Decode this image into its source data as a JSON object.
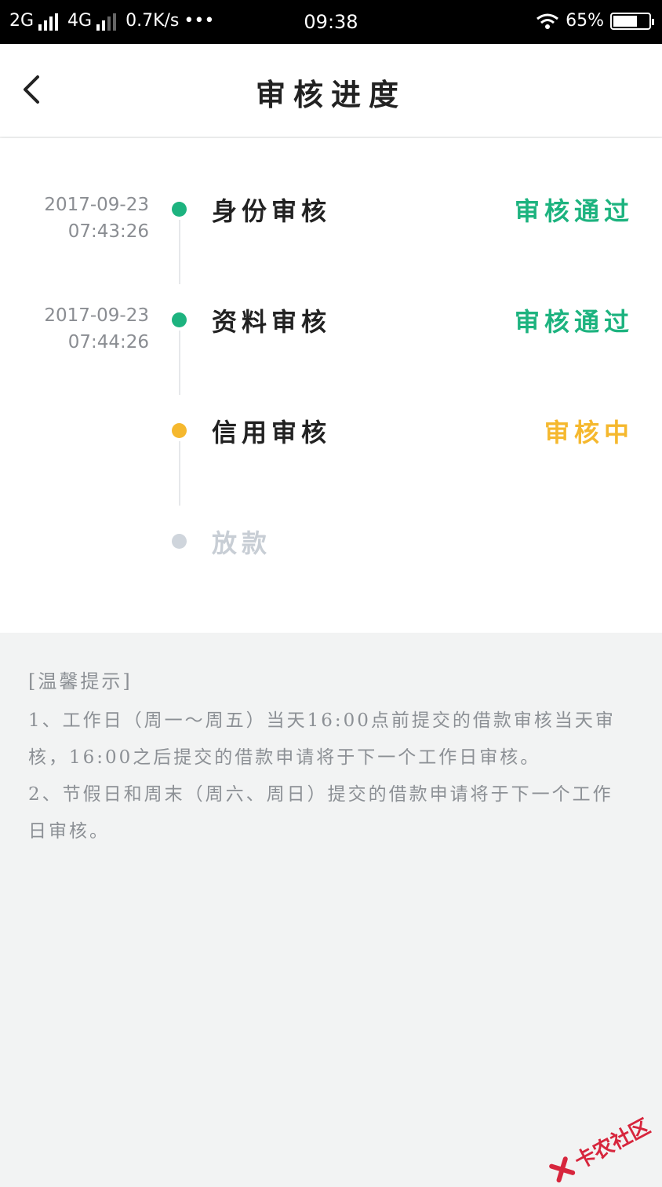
{
  "status_bar": {
    "network1": "2G",
    "network2": "4G",
    "speed": "0.7K/s",
    "dots": "•••",
    "time": "09:38",
    "battery": "65%"
  },
  "header": {
    "title": "审核进度"
  },
  "steps": [
    {
      "date": "2017-09-23",
      "time": "07:43:26",
      "name": "身份审核",
      "status": "审核通过",
      "state": "done"
    },
    {
      "date": "2017-09-23",
      "time": "07:44:26",
      "name": "资料审核",
      "status": "审核通过",
      "state": "done"
    },
    {
      "date": "",
      "time": "",
      "name": "信用审核",
      "status": "审核中",
      "state": "in-progress"
    },
    {
      "date": "",
      "time": "",
      "name": "放款",
      "status": "",
      "state": "pending"
    }
  ],
  "colors": {
    "done": "#1db37f",
    "in_progress": "#f5b82e",
    "pending": "#cfd5dc",
    "pending_text": "#c8ced5"
  },
  "tips": {
    "title": "[温馨提示]",
    "line1": "1、工作日（周一～周五）当天16:00点前提交的借款审核当天审核，16:00之后提交的借款申请将于下一个工作日审核。",
    "line2": "2、节假日和周末（周六、周日）提交的借款申请将于下一个工作日审核。"
  },
  "watermark": {
    "text": "卡农社区"
  }
}
